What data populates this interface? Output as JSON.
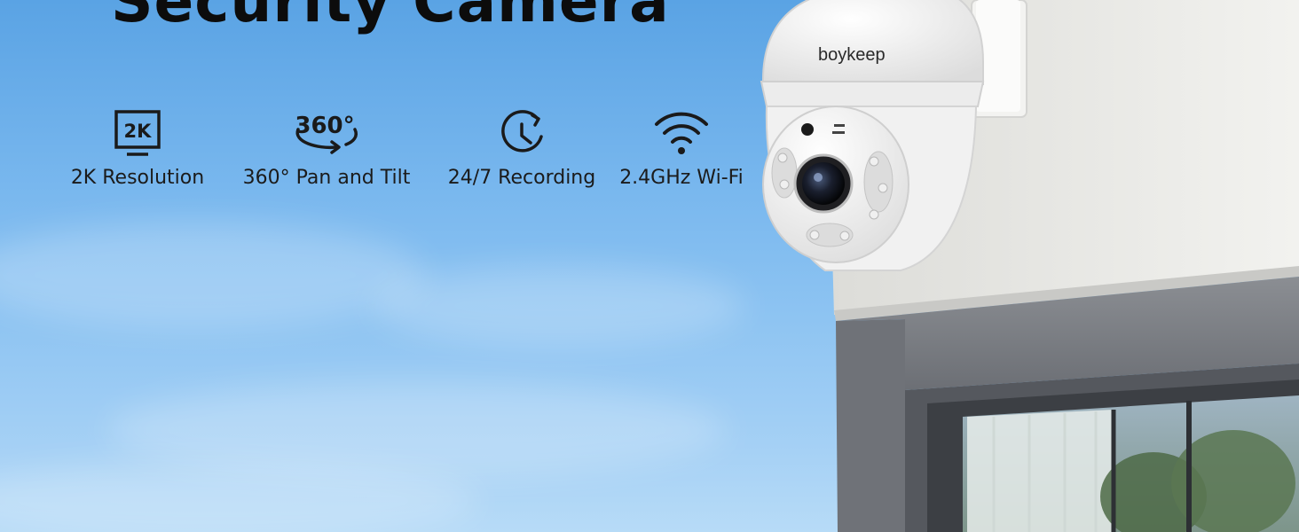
{
  "headline": "Security Camera",
  "features": [
    {
      "icon": "2k-resolution-icon",
      "icon_text": "2K",
      "label": "2K Resolution"
    },
    {
      "icon": "360-rotation-icon",
      "icon_text": "360°",
      "label": "360° Pan and Tilt"
    },
    {
      "icon": "clock-icon",
      "label": "24/7 Recording"
    },
    {
      "icon": "wifi-icon",
      "label": "2.4GHz Wi-Fi"
    }
  ],
  "camera": {
    "brand": "boykeep"
  },
  "colors": {
    "sky_top": "#5aa3e4",
    "sky_bottom": "#b7dbf7",
    "wall": "#e9e9e6",
    "trim": "#7d8086",
    "camera_body": "#f4f4f4",
    "text": "#111111"
  }
}
